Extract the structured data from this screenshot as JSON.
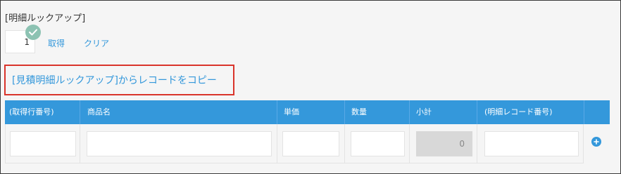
{
  "lookup_field": {
    "label": "[明細ルックアップ]",
    "value": "1",
    "get_label": "取得",
    "clear_label": "クリア"
  },
  "copy_link": {
    "label": "[見積明細ルックアップ]からレコードをコピー"
  },
  "table": {
    "columns": [
      "(取得行番号)",
      "商品名",
      "単価",
      "数量",
      "小計",
      "(明細レコード番号)"
    ],
    "rows": [
      {
        "cells": [
          "",
          "",
          "",
          "",
          "0",
          ""
        ]
      }
    ]
  },
  "colors": {
    "accent": "#3498db",
    "highlight_border": "#d9342b",
    "check_badge": "#8cc2b2",
    "disabled_cell": "#d8d8d8"
  },
  "icons": {
    "check": "check-icon",
    "add": "plus-icon"
  }
}
